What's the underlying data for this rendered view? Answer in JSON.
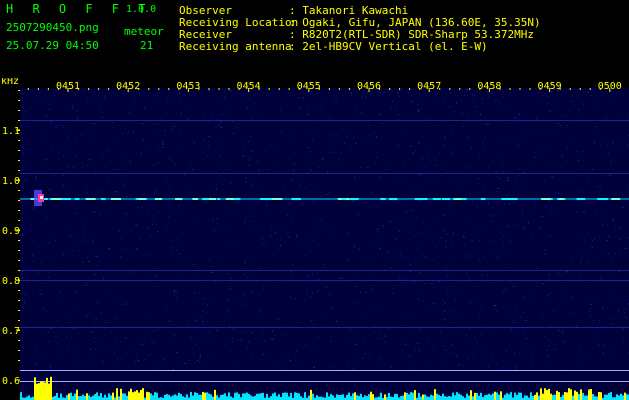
{
  "header": {
    "app_name": "H R O F F T",
    "version": "1.0.0",
    "filename": "2507290450.png",
    "datetime": "25.07.29 04:50",
    "meteor_label": "meteor",
    "meteor_count": "21",
    "info": [
      {
        "label": "Observer",
        "value": ": Takanori Kawachi"
      },
      {
        "label": "Receiving Location",
        "value": ": Ogaki, Gifu, JAPAN (136.60E, 35.35N)"
      },
      {
        "label": "Receiver",
        "value": ": R820T2(RTL-SDR) SDR-Sharp 53.372MHz"
      },
      {
        "label": "Receiving antenna",
        "value": ": 2el-HB9CV Vertical (el. E-W)"
      }
    ]
  },
  "spectrogram": {
    "y_unit": "kHz",
    "time_labels": [
      "0451",
      "0452",
      "0453",
      "0454",
      "0455",
      "0456",
      "0457",
      "0458",
      "0459",
      "0500"
    ],
    "freq_labels": [
      "1.1",
      "1.0",
      "0.9",
      "0.8",
      "0.7",
      "0.6"
    ],
    "colors": {
      "background": "#00003a",
      "carrier": "#00c8ff",
      "axis_text": "#ffff00",
      "bars": "#00e5ff",
      "bar_peak": "#ffff00"
    }
  }
}
